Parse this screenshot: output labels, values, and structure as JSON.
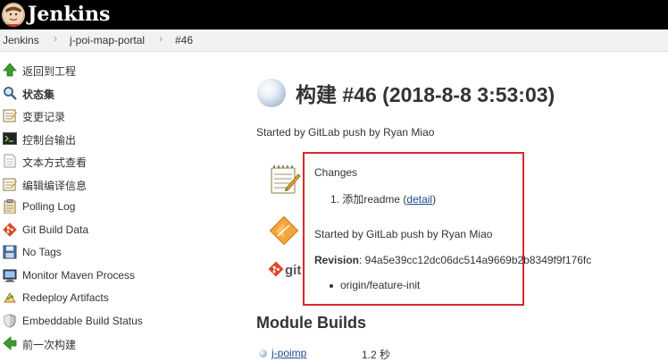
{
  "header": {
    "brand": "Jenkins"
  },
  "breadcrumb": [
    {
      "label": "Jenkins"
    },
    {
      "label": "j-poi-map-portal"
    },
    {
      "label": "#46"
    }
  ],
  "breadcrumb_separator": "›",
  "sidebar": {
    "items": [
      {
        "label": "返回到工程",
        "icon": "up-arrow-icon"
      },
      {
        "label": "状态集",
        "icon": "search-icon"
      },
      {
        "label": "变更记录",
        "icon": "notepad-icon"
      },
      {
        "label": "控制台输出",
        "icon": "terminal-icon"
      },
      {
        "label": "文本方式查看",
        "icon": "document-icon"
      },
      {
        "label": "编辑编译信息",
        "icon": "notepad-icon"
      },
      {
        "label": "Polling Log",
        "icon": "clipboard-icon"
      },
      {
        "label": "Git Build Data",
        "icon": "git-icon"
      },
      {
        "label": "No Tags",
        "icon": "floppy-icon"
      },
      {
        "label": "Monitor Maven Process",
        "icon": "computer-icon"
      },
      {
        "label": "Redeploy Artifacts",
        "icon": "redeploy-icon"
      },
      {
        "label": "Embeddable Build Status",
        "icon": "shield-icon"
      },
      {
        "label": "前一次构建",
        "icon": "left-arrow-icon"
      }
    ]
  },
  "main": {
    "title": "构建 #46 (2018-8-8 3:53:03)",
    "started_by": "Started by GitLab push by Ryan Miao",
    "changes": {
      "heading": "Changes",
      "items": [
        {
          "number": "1.",
          "text": "添加readme",
          "open": "(",
          "link": "detail",
          "close": ")"
        }
      ]
    },
    "gitlab_cause": "Started by GitLab push by Ryan Miao",
    "revision": {
      "label": "Revision",
      "value": ": 94a5e39cc12dc06dc514a9669b2b8349f9f176fc"
    },
    "branches": [
      "origin/feature-init"
    ],
    "git_icon_text": "git",
    "module_builds": {
      "heading": "Module Builds",
      "rows": [
        {
          "name": "j-poimp",
          "duration": "1.2 秒"
        }
      ]
    }
  },
  "colors": {
    "topbar": "#000000",
    "highlight_border": "#d9282e",
    "link": "#204a87",
    "git_orange": "#d9492c"
  }
}
